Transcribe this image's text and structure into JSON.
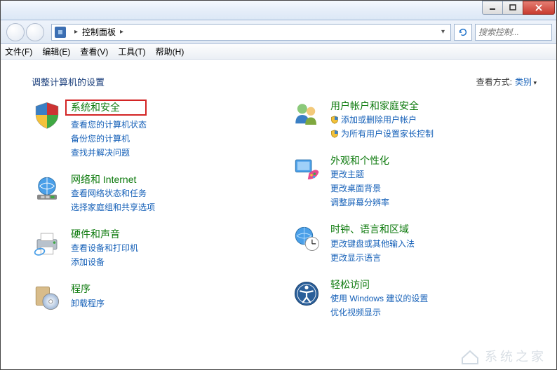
{
  "window": {
    "title": "控制面板"
  },
  "titlebar_buttons": {
    "min": "minimize",
    "max": "maximize",
    "close": "close"
  },
  "addressbar": {
    "location": "控制面板",
    "separator": "▸"
  },
  "search": {
    "placeholder": "搜索控制..."
  },
  "menubar": {
    "file": "文件(F)",
    "edit": "编辑(E)",
    "view": "查看(V)",
    "tools": "工具(T)",
    "help": "帮助(H)"
  },
  "heading": "调整计算机的设置",
  "viewby": {
    "label": "查看方式:",
    "value": "类别"
  },
  "categories": {
    "system_security": {
      "title": "系统和安全",
      "links": [
        "查看您的计算机状态",
        "备份您的计算机",
        "查找并解决问题"
      ]
    },
    "network": {
      "title": "网络和 Internet",
      "links": [
        "查看网络状态和任务",
        "选择家庭组和共享选项"
      ]
    },
    "hardware": {
      "title": "硬件和声音",
      "links": [
        "查看设备和打印机",
        "添加设备"
      ]
    },
    "programs": {
      "title": "程序",
      "links": [
        "卸载程序"
      ]
    },
    "users": {
      "title": "用户帐户和家庭安全",
      "links": [
        "添加或删除用户帐户",
        "为所有用户设置家长控制"
      ]
    },
    "appearance": {
      "title": "外观和个性化",
      "links": [
        "更改主题",
        "更改桌面背景",
        "调整屏幕分辨率"
      ]
    },
    "clock": {
      "title": "时钟、语言和区域",
      "links": [
        "更改键盘或其他输入法",
        "更改显示语言"
      ]
    },
    "ease": {
      "title": "轻松访问",
      "links": [
        "使用 Windows 建议的设置",
        "优化视频显示"
      ]
    }
  },
  "watermark": "系统之家"
}
